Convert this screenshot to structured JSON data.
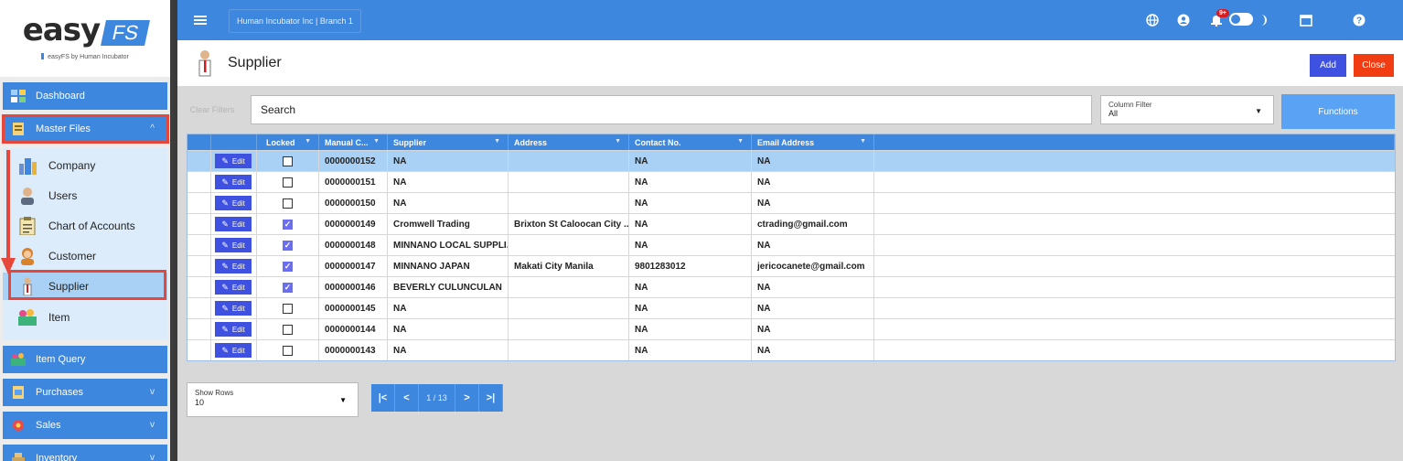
{
  "logo": {
    "main": "easy",
    "accent": "FS",
    "subtitle": "easyFS by Human Incubator"
  },
  "sidebar": {
    "dashboard": "Dashboard",
    "master_files": "Master Files",
    "sub_items": [
      "Company",
      "Users",
      "Chart of Accounts",
      "Customer",
      "Supplier",
      "Item"
    ],
    "item_query": "Item Query",
    "purchases": "Purchases",
    "sales": "Sales",
    "inventory": "Inventory"
  },
  "topbar": {
    "branch": "Human Incubator Inc | Branch 1",
    "notification_count": "9+"
  },
  "header": {
    "title": "Supplier",
    "add_label": "Add",
    "close_label": "Close"
  },
  "toolbar": {
    "clear_filters": "Clear Filters",
    "search_placeholder": "Search",
    "column_filter_label": "Column Filter",
    "column_filter_value": "All",
    "functions_label": "Functions"
  },
  "table": {
    "columns": [
      "Locked",
      "Manual C...",
      "Supplier",
      "Address",
      "Contact No.",
      "Email Address"
    ],
    "edit_label": "Edit",
    "rows": [
      {
        "locked": false,
        "code": "0000000152",
        "supplier": "NA",
        "address": "",
        "contact": "NA",
        "email": "NA"
      },
      {
        "locked": false,
        "code": "0000000151",
        "supplier": "NA",
        "address": "",
        "contact": "NA",
        "email": "NA"
      },
      {
        "locked": false,
        "code": "0000000150",
        "supplier": "NA",
        "address": "",
        "contact": "NA",
        "email": "NA"
      },
      {
        "locked": true,
        "code": "0000000149",
        "supplier": "Cromwell Trading",
        "address": "Brixton St Caloocan City ...",
        "contact": "NA",
        "email": "ctrading@gmail.com"
      },
      {
        "locked": true,
        "code": "0000000148",
        "supplier": "MINNANO LOCAL SUPPLI...",
        "address": "",
        "contact": "NA",
        "email": "NA"
      },
      {
        "locked": true,
        "code": "0000000147",
        "supplier": "MINNANO JAPAN",
        "address": "Makati City Manila",
        "contact": "9801283012",
        "email": "jericocanete@gmail.com"
      },
      {
        "locked": true,
        "code": "0000000146",
        "supplier": "BEVERLY CULUNCULAN",
        "address": "",
        "contact": "NA",
        "email": "NA"
      },
      {
        "locked": false,
        "code": "0000000145",
        "supplier": "NA",
        "address": "",
        "contact": "NA",
        "email": "NA"
      },
      {
        "locked": false,
        "code": "0000000144",
        "supplier": "NA",
        "address": "",
        "contact": "NA",
        "email": "NA"
      },
      {
        "locked": false,
        "code": "0000000143",
        "supplier": "NA",
        "address": "",
        "contact": "NA",
        "email": "NA"
      }
    ]
  },
  "pager": {
    "show_rows_label": "Show Rows",
    "show_rows_value": "10",
    "page_label": "1 / 13"
  },
  "colors": {
    "primary": "#3d87de",
    "add": "#3f51e0",
    "close": "#f23c12",
    "highlight": "#e5473a",
    "selected_row": "#a9d1f5"
  }
}
